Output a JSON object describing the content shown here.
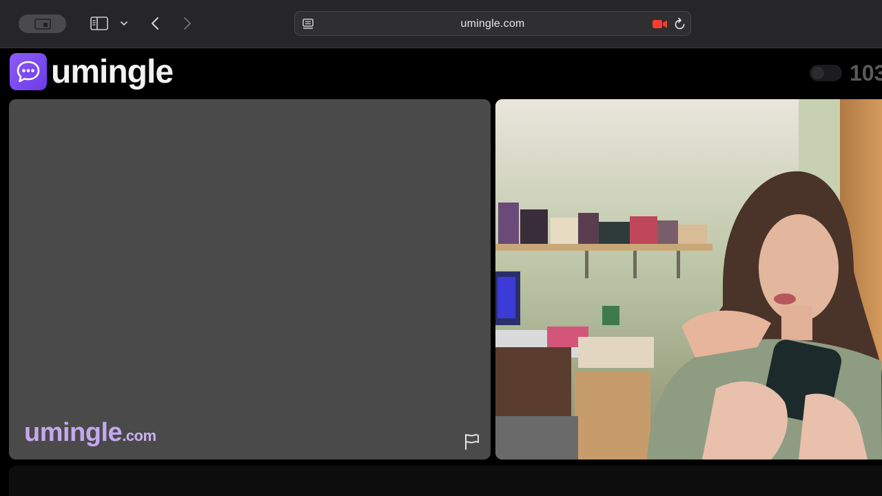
{
  "browser": {
    "url": "umingle.com"
  },
  "site": {
    "logo_text": "umingle",
    "online_count": "103",
    "watermark_name": "umingle",
    "watermark_tld": ".com"
  },
  "icons": {
    "tab_overview": "tab-overview-icon",
    "sidebar": "sidebar-icon",
    "chevron": "chevron-down-icon",
    "back": "back-arrow-icon",
    "forward": "forward-arrow-icon",
    "page": "page-menu-icon",
    "camera": "camera-recording-icon",
    "reload": "reload-icon",
    "logo": "chat-bubble-icon",
    "report": "flag-icon"
  },
  "colors": {
    "brand": "#7c4dff",
    "watermark": "#c4a9ee",
    "camera_active": "#ff3b30"
  }
}
